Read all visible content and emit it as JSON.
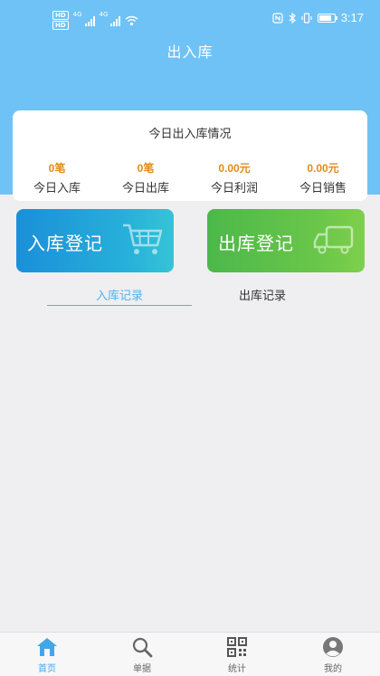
{
  "status_bar": {
    "hd_badges": [
      "HD",
      "HD"
    ],
    "network_labels": [
      "4G",
      "4G"
    ],
    "time": "3:17",
    "icons": [
      "nfc-icon",
      "bluetooth-icon",
      "vibrate-icon",
      "battery-icon"
    ]
  },
  "header": {
    "title": "出入库"
  },
  "summary": {
    "title": "今日出入库情况",
    "stats": [
      {
        "value": "0笔",
        "label": "今日入库"
      },
      {
        "value": "0笔",
        "label": "今日出库"
      },
      {
        "value": "0.00元",
        "label": "今日利润"
      },
      {
        "value": "0.00元",
        "label": "今日销售"
      }
    ]
  },
  "actions": {
    "in": {
      "label": "入库登记",
      "icon": "cart-icon"
    },
    "out": {
      "label": "出库登记",
      "icon": "truck-icon"
    }
  },
  "tabs": [
    {
      "label": "入库记录",
      "active": true
    },
    {
      "label": "出库记录",
      "active": false
    }
  ],
  "bottom_nav": [
    {
      "label": "首页",
      "icon": "home-icon",
      "active": true
    },
    {
      "label": "单据",
      "icon": "search-icon",
      "active": false
    },
    {
      "label": "统计",
      "icon": "qrcode-icon",
      "active": false
    },
    {
      "label": "我的",
      "icon": "user-icon",
      "active": false
    }
  ],
  "colors": {
    "header_bg": "#6fc2f6",
    "accent": "#4fb2ea",
    "stat_value": "#e28a1b",
    "btn_in": "#1b8fd9",
    "btn_out": "#4cb84a"
  }
}
